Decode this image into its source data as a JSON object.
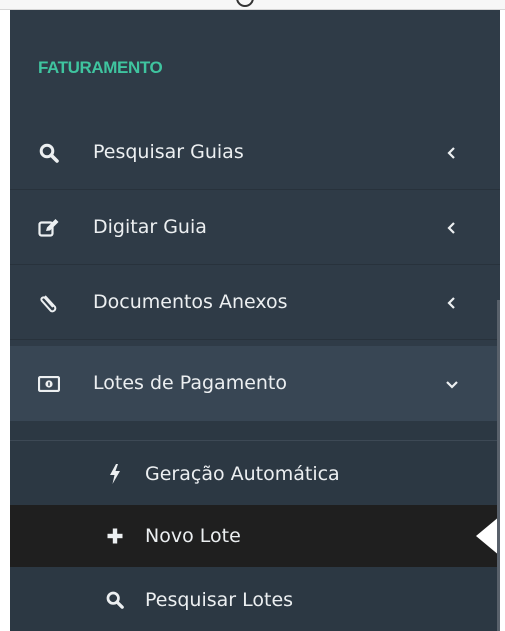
{
  "sidebar": {
    "section_title": "FATURAMENTO",
    "items": [
      {
        "label": "Pesquisar Guias",
        "icon": "search-icon",
        "expanded": false
      },
      {
        "label": "Digitar Guia",
        "icon": "edit-icon",
        "expanded": false
      },
      {
        "label": "Documentos Anexos",
        "icon": "paperclip-icon",
        "expanded": false
      },
      {
        "label": "Lotes de Pagamento",
        "icon": "money-icon",
        "expanded": true
      }
    ],
    "submenu": [
      {
        "label": "Geração Automática",
        "icon": "bolt-icon",
        "active": false
      },
      {
        "label": "Novo Lote",
        "icon": "plus-icon",
        "active": true
      },
      {
        "label": "Pesquisar Lotes",
        "icon": "search-icon",
        "active": false
      }
    ]
  },
  "colors": {
    "sidebar_bg": "#2f3b47",
    "section_title": "#3fc49f",
    "active_item_bg": "#1f1f1f",
    "open_item_bg": "#384654",
    "text": "#eceff1"
  }
}
